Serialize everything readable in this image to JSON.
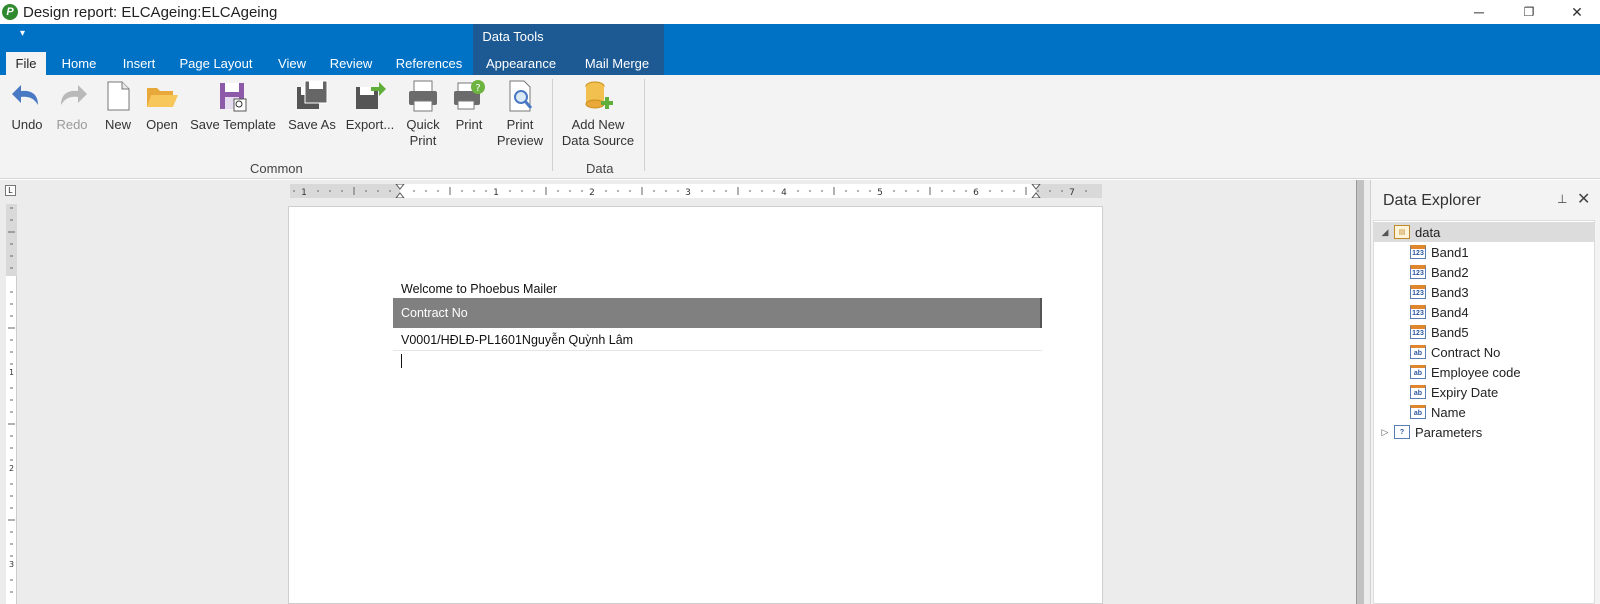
{
  "window": {
    "title": "Design report: ELCAgeing:ELCAgeing",
    "minimize": "─",
    "restore": "❐",
    "close": "✕"
  },
  "ribbon": {
    "quick_access": "▾",
    "context_title": "Data Tools",
    "tabs": [
      "File",
      "Home",
      "Insert",
      "Page Layout",
      "View",
      "Review",
      "References",
      "Appearance",
      "Mail Merge"
    ],
    "active_tab": "File",
    "buttons": {
      "undo": "Undo",
      "redo": "Redo",
      "new": "New",
      "open": "Open",
      "save_template": "Save Template",
      "save_as": "Save As",
      "export": "Export...",
      "quick_print_1": "Quick",
      "quick_print_2": "Print",
      "print": "Print",
      "print_preview_1": "Print",
      "print_preview_2": "Preview",
      "add_ds_1": "Add New",
      "add_ds_2": "Data Source"
    },
    "groups": {
      "common": "Common",
      "data": "Data"
    }
  },
  "document": {
    "welcome_text": "Welcome to Phoebus Mailer",
    "table_header": "Contract No",
    "table_row": "V0001/HĐLĐ-PL1601Nguyễn Quỳnh  Lâm",
    "ruler_numbers": [
      "1",
      "1",
      "2",
      "3",
      "4",
      "5",
      "6",
      "7"
    ],
    "vruler_numbers": [
      "1",
      "2",
      "3"
    ]
  },
  "data_explorer": {
    "title": "Data Explorer",
    "pin": "📌",
    "close": "✕",
    "root": "data",
    "children": [
      "Band1",
      "Band2",
      "Band3",
      "Band4",
      "Band5",
      "Contract No",
      "Employee code",
      "Expiry Date",
      "Name"
    ],
    "parameters": "Parameters"
  }
}
